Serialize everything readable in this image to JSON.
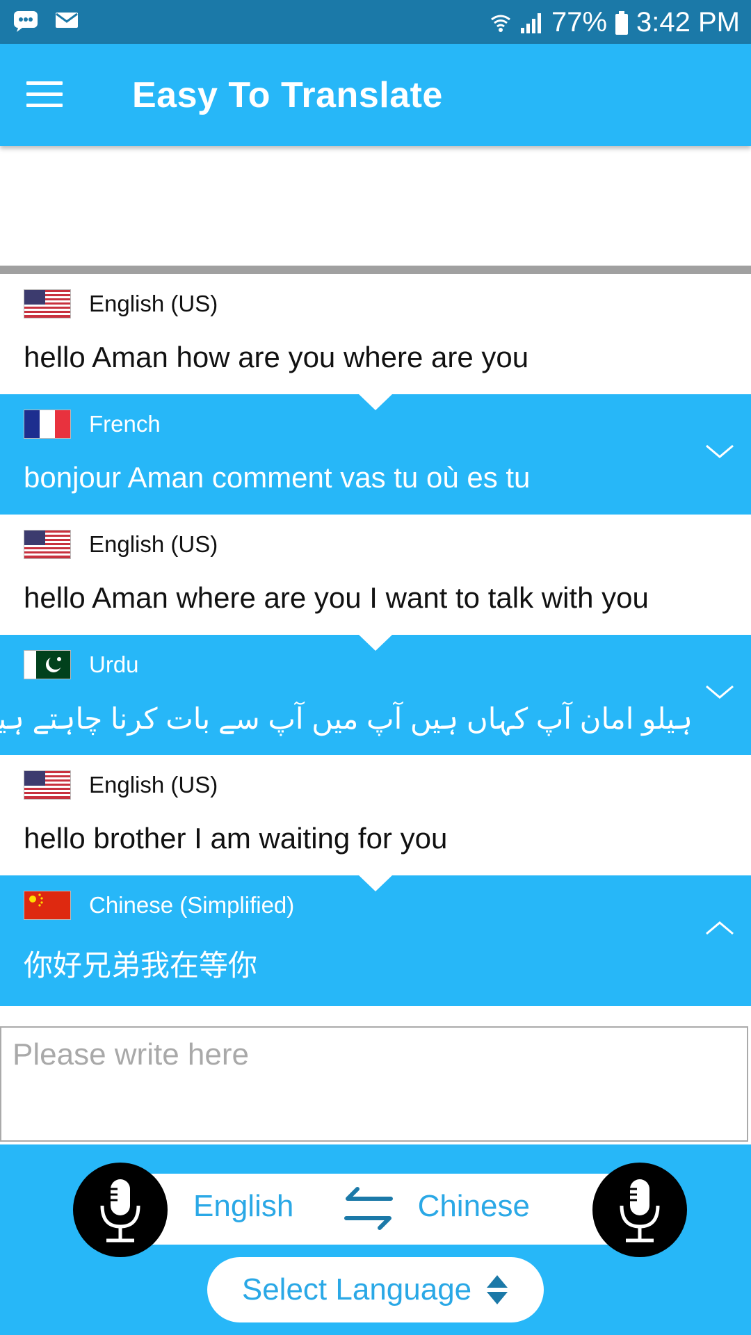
{
  "status_bar": {
    "battery": "77%",
    "time": "3:42 PM"
  },
  "app_bar": {
    "title": "Easy To Translate"
  },
  "conversation": [
    {
      "language": "English (US)",
      "flag": "us-flag",
      "text": "hello Aman how are you where are you",
      "style": "source"
    },
    {
      "language": "French",
      "flag": "fr-flag",
      "text": "bonjour Aman comment vas tu où es tu",
      "style": "translation",
      "expanded": false
    },
    {
      "language": "English (US)",
      "flag": "us-flag",
      "text": "hello Aman where are you I want to talk with you",
      "style": "source"
    },
    {
      "language": "Urdu",
      "flag": "pk-flag",
      "text": "ہیلو امان آپ کہاں ہیں آپ میں آپ سے بات کرنا چاہتے ہیں",
      "style": "translation",
      "expanded": false
    },
    {
      "language": "English (US)",
      "flag": "us-flag",
      "text": "hello brother I am waiting for you",
      "style": "source"
    },
    {
      "language": "Chinese (Simplified)",
      "flag": "cn-flag",
      "text": "你好兄弟我在等你",
      "style": "translation",
      "expanded": true
    }
  ],
  "input": {
    "placeholder": "Please write here",
    "value": ""
  },
  "bottom_bar": {
    "source_language": "English",
    "target_language": "Chinese",
    "select_language_label": "Select Language"
  },
  "colors": {
    "status_bar": "#1b79a8",
    "primary": "#27b7f8",
    "accent_text": "#2aa8e6",
    "divider": "#a0a0a0"
  }
}
